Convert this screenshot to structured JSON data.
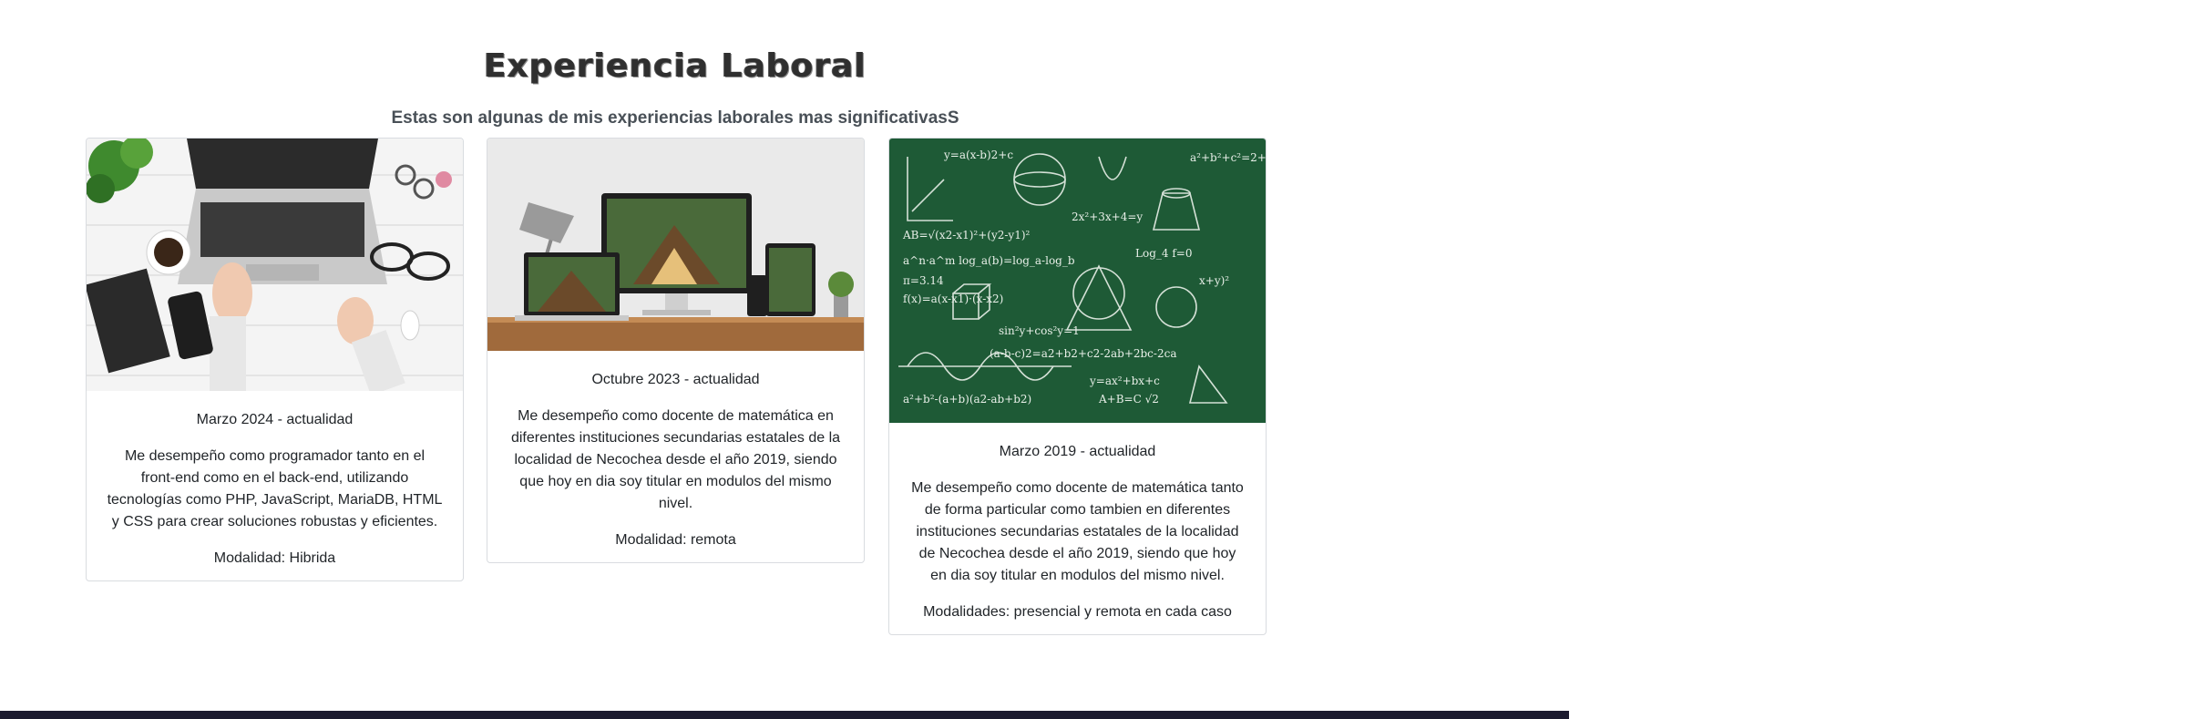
{
  "section": {
    "title": "Experiencia Laboral",
    "subtitle": "Estas son algunas de mis experiencias laborales mas significativasS"
  },
  "cards": [
    {
      "image_icon": "laptop-desk-photo",
      "date": "Marzo 2024 - actualidad",
      "description": "Me desempeño como programador tanto en el front-end como en el back-end, utilizando tecnologías como PHP, JavaScript, MariaDB, HTML y CSS para crear soluciones robustas y eficientes.",
      "mode": "Modalidad: Hibrida"
    },
    {
      "image_icon": "responsive-devices-photo",
      "date": "Octubre 2023 - actualidad",
      "description": "Me desempeño como docente de matemática en diferentes instituciones secundarias estatales de la localidad de Necochea desde el año 2019, siendo que hoy en dia soy titular en modulos del mismo nivel.",
      "mode": "Modalidad: remota"
    },
    {
      "image_icon": "math-chalkboard-photo",
      "date": "Marzo 2019 - actualidad",
      "description": "Me desempeño como docente de matemática tanto de forma particular como tambien en diferentes instituciones secundarias estatales de la localidad de Necochea desde el año 2019, siendo que hoy en dia soy titular en modulos del mismo nivel.",
      "mode": "Modalidades: presencial y remota en cada caso"
    }
  ],
  "colors": {
    "footer": "#1b1a2e",
    "chalkboard": "#1e5a36",
    "card_border": "#d9dce0"
  }
}
